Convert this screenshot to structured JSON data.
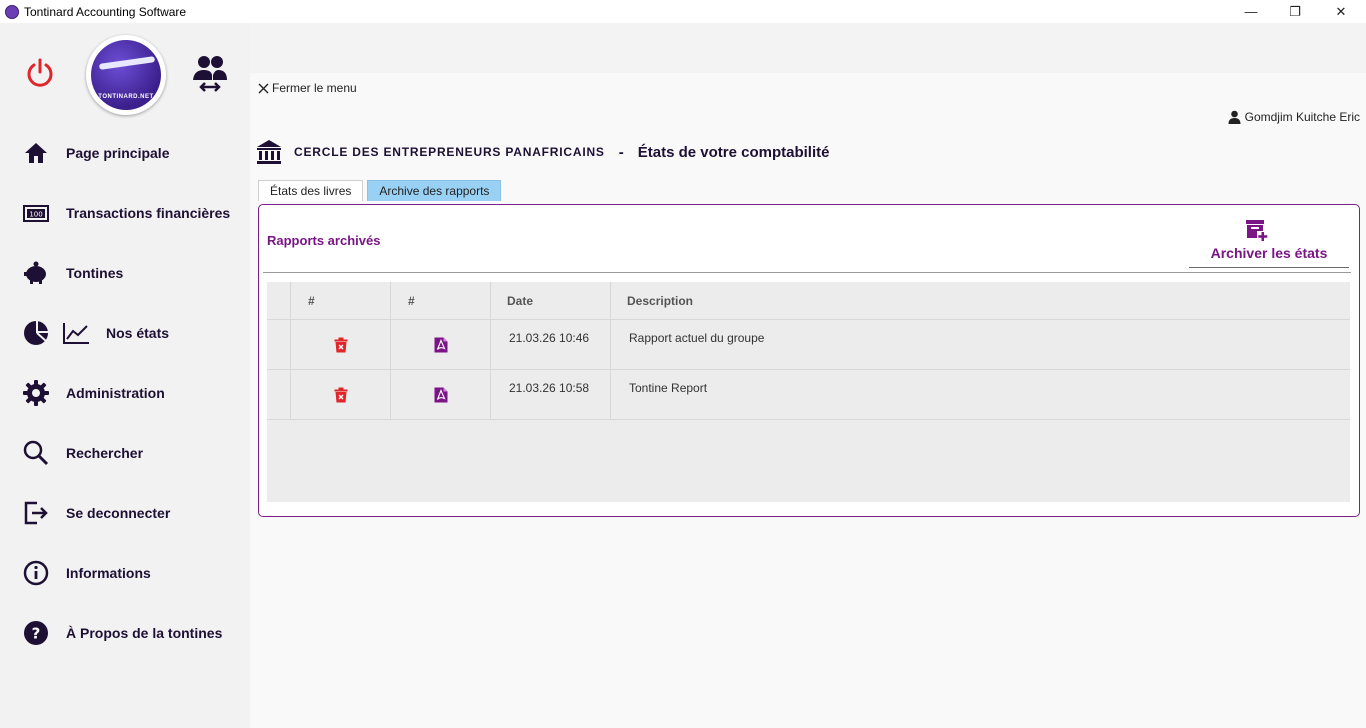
{
  "window": {
    "title": "Tontinard Accounting Software",
    "controls": {
      "minimize": "—",
      "maximize": "❐",
      "close": "✕"
    }
  },
  "sidebar": {
    "logo_text": "TONTINARD.NET",
    "items": [
      {
        "label": "Page principale",
        "icon": "home-icon"
      },
      {
        "label": "Transactions financières",
        "icon": "banknote-icon"
      },
      {
        "label": "Tontines",
        "icon": "piggy-bank-icon"
      },
      {
        "label": "Nos états",
        "icon": "pie-chart-icon"
      },
      {
        "label": "Administration",
        "icon": "gear-icon"
      },
      {
        "label": "Rechercher",
        "icon": "search-icon"
      },
      {
        "label": "Se deconnecter",
        "icon": "logout-icon"
      },
      {
        "label": "Informations",
        "icon": "info-icon"
      },
      {
        "label": "À Propos de la  tontines",
        "icon": "help-icon"
      }
    ]
  },
  "header": {
    "close_menu": "Fermer le menu",
    "user": "Gomdjim Kuitche Eric",
    "organization": "CERCLE DES ENTREPRENEURS PANAFRICAINS",
    "separator": "-",
    "page_title": "États de votre comptabilité"
  },
  "tabs": [
    {
      "label": "États des livres",
      "active": false
    },
    {
      "label": "Archive des rapports",
      "active": true
    }
  ],
  "panel": {
    "title": "Rapports archivés",
    "archive_button": "Archiver les états"
  },
  "table": {
    "columns": [
      "",
      "#",
      "#",
      "Date",
      "Description"
    ],
    "rows": [
      {
        "date": "21.03.26 10:46",
        "description": "Rapport actuel du groupe"
      },
      {
        "date": "21.03.26 10:58",
        "description": "Tontine Report"
      }
    ]
  },
  "colors": {
    "accent_purple": "#7a1585",
    "sidebar_text": "#1e1034",
    "power_red": "#e0262a",
    "delete_red": "#e0262a",
    "active_tab": "#99d1f5"
  }
}
